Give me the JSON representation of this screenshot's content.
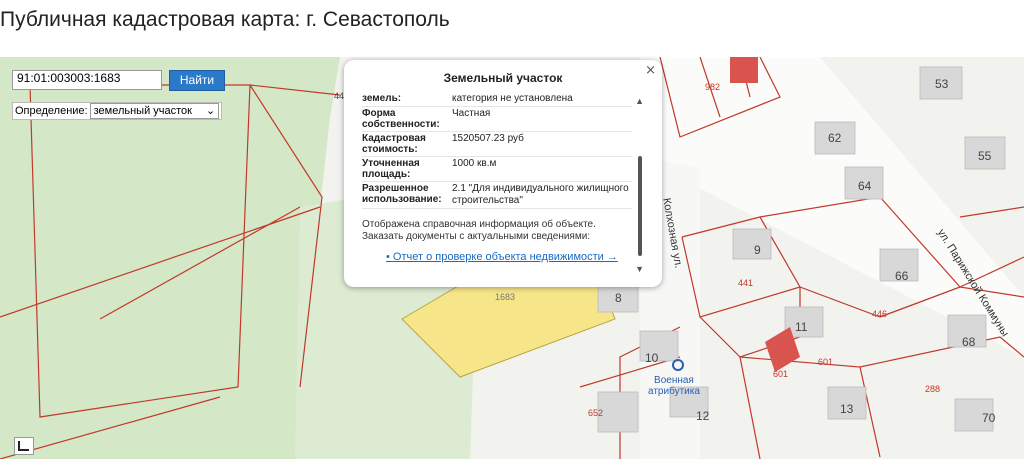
{
  "page": {
    "title": "Публичная кадастровая карта: г. Севастополь"
  },
  "search": {
    "value": "91:01:003003:1683",
    "button_label": "Найти"
  },
  "definition": {
    "label": "Определение:",
    "selected": "земельный участок"
  },
  "popup": {
    "title": "Земельный участок",
    "close": "×",
    "rows": [
      {
        "key": "земель:",
        "value": "категория не установлена"
      },
      {
        "key": "Форма собственности:",
        "value": "Частная"
      },
      {
        "key": "Кадастровая стоимость:",
        "value": "1520507.23 руб"
      },
      {
        "key": "Уточненная площадь:",
        "value": "1000 кв.м"
      },
      {
        "key": "Разрешенное использование:",
        "value": "2.1 \"Для индивидуального жилищного строительства\""
      }
    ],
    "note_line1": "Отображена справочная информация об объекте.",
    "note_line2": "Заказать документы с актуальными сведениями:",
    "link": "Отчет о проверке объекта недвижимости →"
  },
  "map": {
    "streets": {
      "kolkhoznaya": "Колхозная ул.",
      "parizhskoy": "ул. Парижской Коммуны"
    },
    "poi": {
      "line1": "Военная",
      "line2": "атрибутика"
    },
    "houses": [
      "53",
      "62",
      "55",
      "64",
      "9",
      "66",
      "8",
      "11",
      "68",
      "10",
      "12",
      "13",
      "70",
      "44"
    ],
    "parcels": [
      "982",
      "441",
      "446",
      "601",
      "601",
      "288",
      "652",
      "1683"
    ]
  },
  "colors": {
    "parcel_line": "#c0392b",
    "selected_parcel": "#f7e58a",
    "button": "#2b7ac9",
    "green": "#d4e8c8"
  }
}
